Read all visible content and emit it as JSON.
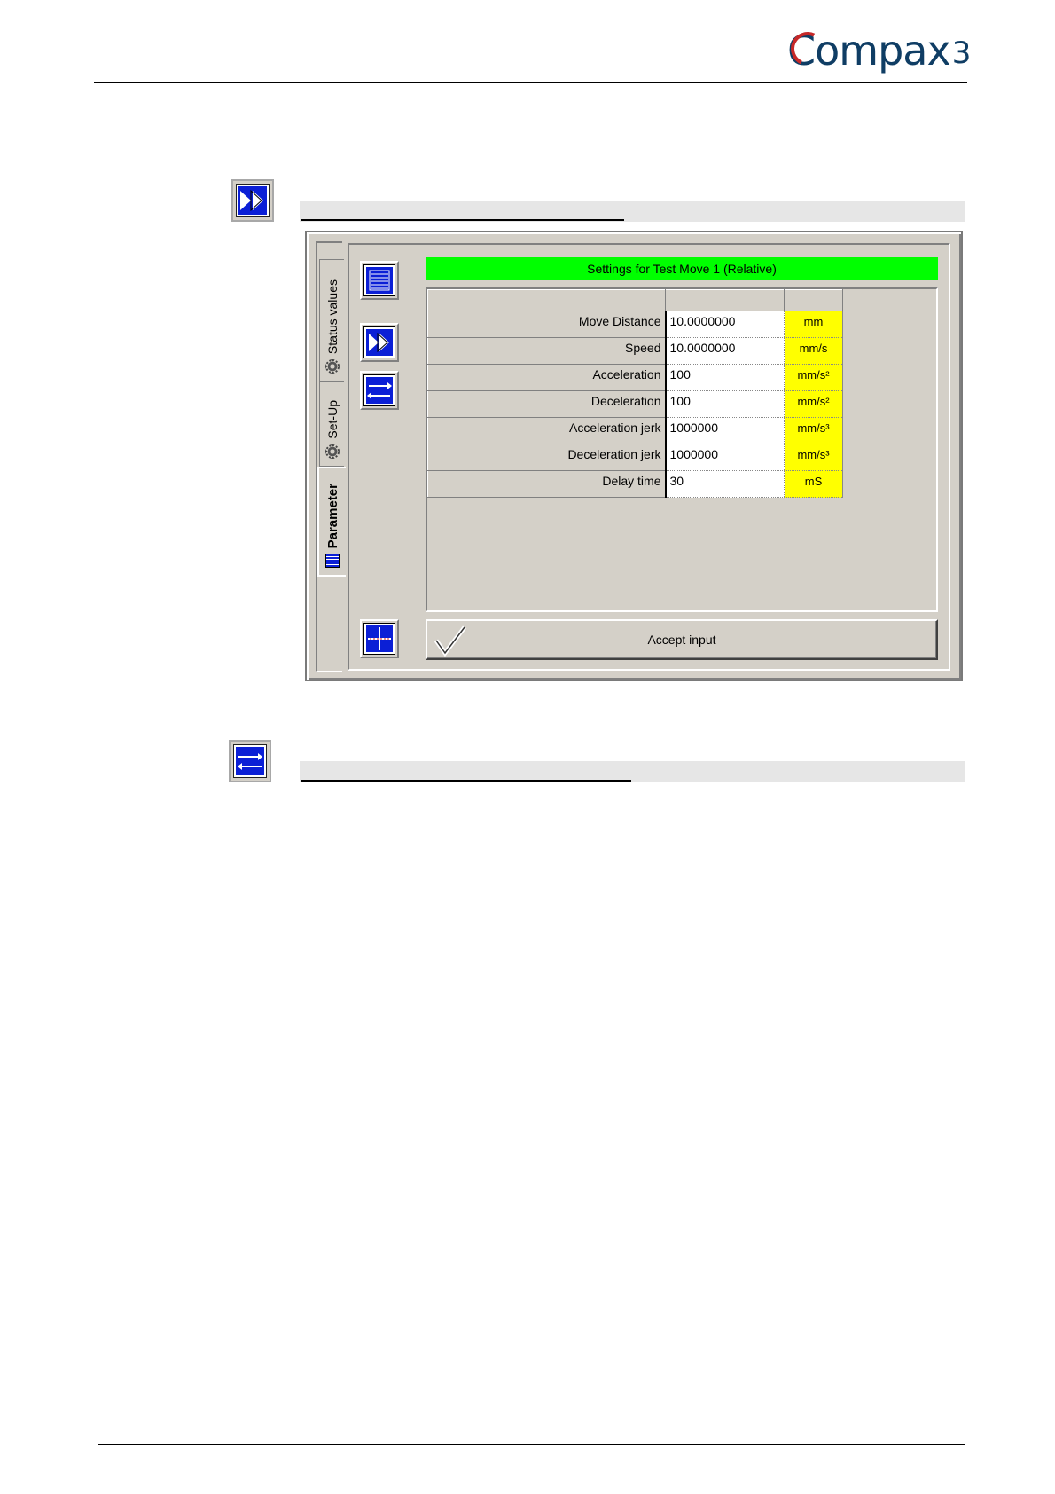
{
  "header": {
    "logo_main": "ompax",
    "logo_c": "C",
    "logo_suffix": "3"
  },
  "section1": {
    "icon": "fast-forward-icon"
  },
  "section2": {
    "icon": "swap-arrows-icon"
  },
  "window": {
    "tabs": [
      {
        "label": "Status values",
        "icon": "gear-icon"
      },
      {
        "label": "Set-Up",
        "icon": "gear-icon"
      },
      {
        "label": "Parameter",
        "icon": "list-icon"
      }
    ],
    "title": "Settings for Test Move 1 (Relative)",
    "rows": [
      {
        "name": "Move Distance",
        "value": "10.0000000",
        "unit": "mm"
      },
      {
        "name": "Speed",
        "value": "10.0000000",
        "unit": "mm/s"
      },
      {
        "name": "Acceleration",
        "value": "100",
        "unit": "mm/s²"
      },
      {
        "name": "Deceleration",
        "value": "100",
        "unit": "mm/s²"
      },
      {
        "name": "Acceleration jerk",
        "value": "1000000",
        "unit": "mm/s³"
      },
      {
        "name": "Deceleration jerk",
        "value": "1000000",
        "unit": "mm/s³"
      },
      {
        "name": "Delay time",
        "value": "30",
        "unit": "mS"
      }
    ],
    "accept_label": "Accept input",
    "colors": {
      "title_bg": "#00ff00",
      "unit_bg": "#ffff00",
      "icon_blue": "#0b1fd6",
      "face": "#d4d0c8"
    }
  }
}
